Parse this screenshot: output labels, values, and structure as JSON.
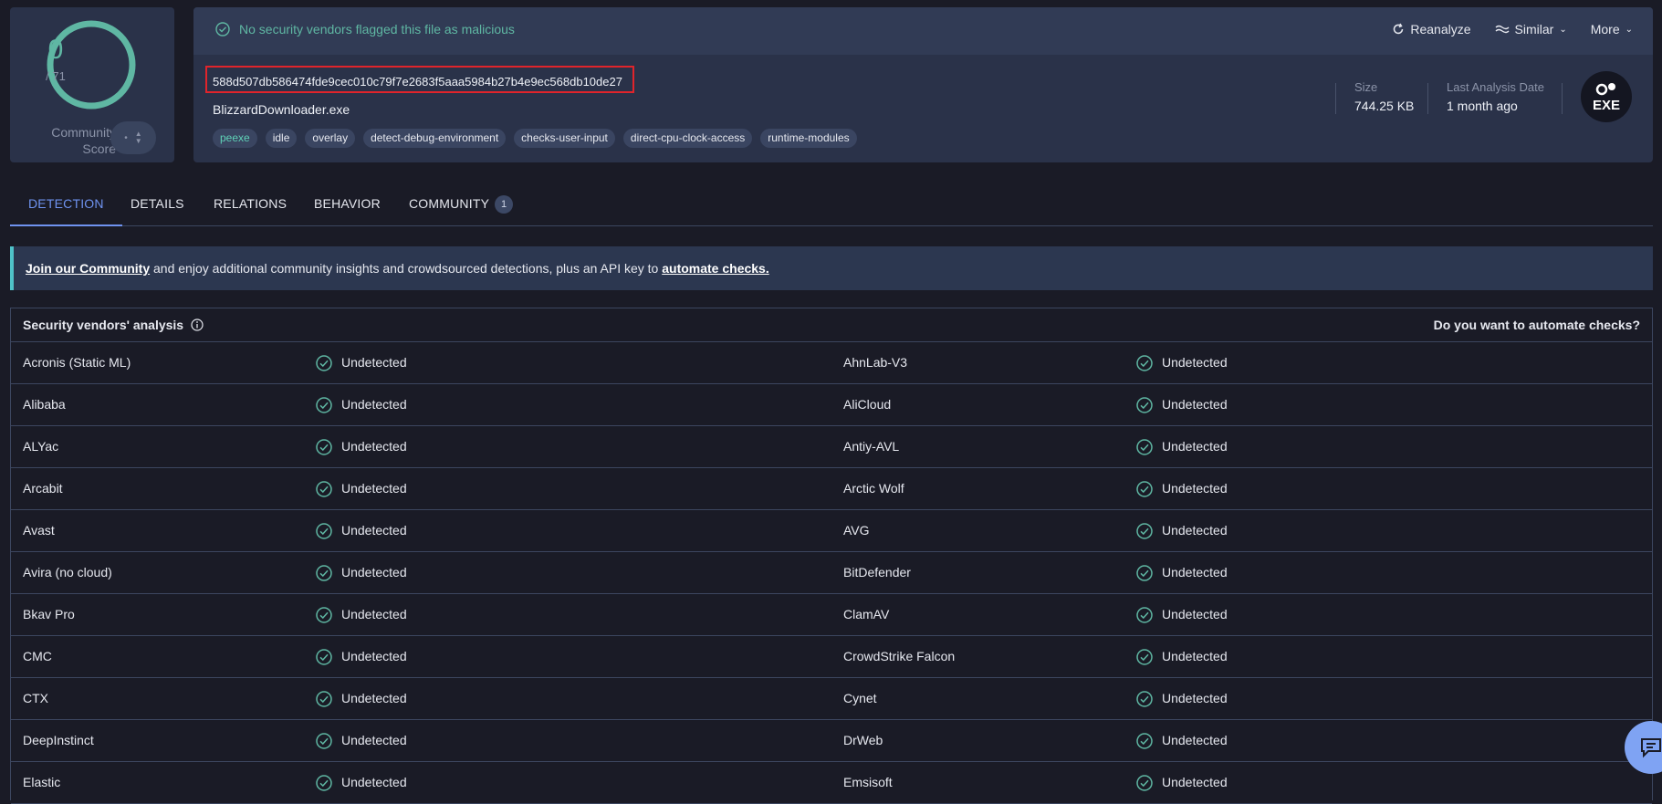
{
  "score": {
    "value": "0",
    "total": "/ 71",
    "community_label": "Community Score"
  },
  "status": {
    "message": "No security vendors flagged this file as malicious"
  },
  "actions": {
    "reanalyze": "Reanalyze",
    "similar": "Similar",
    "more": "More"
  },
  "file": {
    "hash": "588d507db586474fde9cec010c79f7e2683f5aaa5984b27b4e9ec568db10de27",
    "name": "BlizzardDownloader.exe",
    "tags": [
      "peexe",
      "idle",
      "overlay",
      "detect-debug-environment",
      "checks-user-input",
      "direct-cpu-clock-access",
      "runtime-modules"
    ],
    "size_label": "Size",
    "size_value": "744.25 KB",
    "date_label": "Last Analysis Date",
    "date_value": "1 month ago",
    "type_badge": "EXE"
  },
  "tabs": [
    {
      "label": "DETECTION",
      "active": true
    },
    {
      "label": "DETAILS"
    },
    {
      "label": "RELATIONS"
    },
    {
      "label": "BEHAVIOR"
    },
    {
      "label": "COMMUNITY",
      "badge": "1"
    }
  ],
  "banner": {
    "link1": "Join our Community",
    "text": " and enjoy additional community insights and crowdsourced detections, plus an API key to ",
    "link2": "automate checks."
  },
  "vendors": {
    "title": "Security vendors' analysis",
    "automate": "Do you want to automate checks?",
    "rows": [
      {
        "v1": "Acronis (Static ML)",
        "r1": "Undetected",
        "v2": "AhnLab-V3",
        "r2": "Undetected"
      },
      {
        "v1": "Alibaba",
        "r1": "Undetected",
        "v2": "AliCloud",
        "r2": "Undetected"
      },
      {
        "v1": "ALYac",
        "r1": "Undetected",
        "v2": "Antiy-AVL",
        "r2": "Undetected"
      },
      {
        "v1": "Arcabit",
        "r1": "Undetected",
        "v2": "Arctic Wolf",
        "r2": "Undetected"
      },
      {
        "v1": "Avast",
        "r1": "Undetected",
        "v2": "AVG",
        "r2": "Undetected"
      },
      {
        "v1": "Avira (no cloud)",
        "r1": "Undetected",
        "v2": "BitDefender",
        "r2": "Undetected"
      },
      {
        "v1": "Bkav Pro",
        "r1": "Undetected",
        "v2": "ClamAV",
        "r2": "Undetected"
      },
      {
        "v1": "CMC",
        "r1": "Undetected",
        "v2": "CrowdStrike Falcon",
        "r2": "Undetected"
      },
      {
        "v1": "CTX",
        "r1": "Undetected",
        "v2": "Cynet",
        "r2": "Undetected"
      },
      {
        "v1": "DeepInstinct",
        "r1": "Undetected",
        "v2": "DrWeb",
        "r2": "Undetected"
      },
      {
        "v1": "Elastic",
        "r1": "Undetected",
        "v2": "Emsisoft",
        "r2": "Undetected"
      }
    ]
  },
  "colors": {
    "accent": "#6f93f0",
    "ok": "#5fb7a3",
    "highlight": "#e0242b"
  }
}
